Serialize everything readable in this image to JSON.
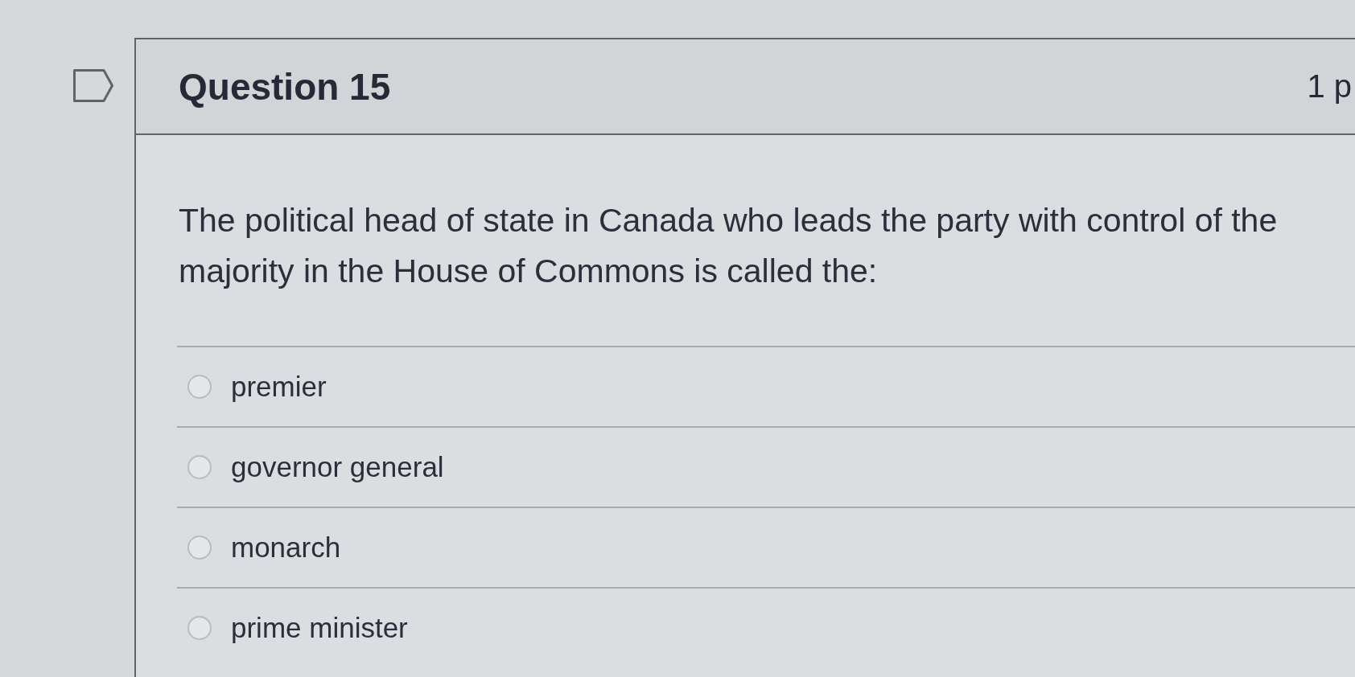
{
  "flag": {
    "flagged": false
  },
  "question": {
    "title": "Question 15",
    "points": "1 p",
    "text": "The political head of state in Canada who leads the party with control of the majority in the House of Commons is called the:"
  },
  "answers": [
    {
      "label": "premier",
      "selected": false
    },
    {
      "label": "governor general",
      "selected": false
    },
    {
      "label": "monarch",
      "selected": false
    },
    {
      "label": "prime minister",
      "selected": false
    }
  ]
}
